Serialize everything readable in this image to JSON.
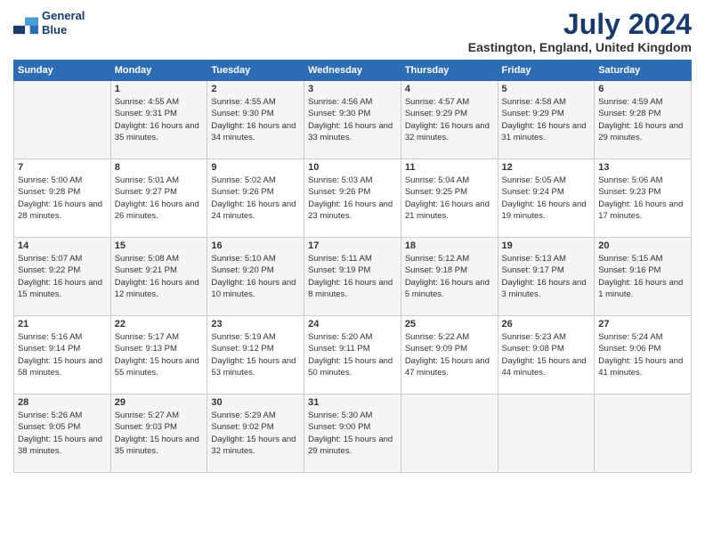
{
  "logo": {
    "line1": "General",
    "line2": "Blue"
  },
  "title": "July 2024",
  "location": "Eastington, England, United Kingdom",
  "days_of_week": [
    "Sunday",
    "Monday",
    "Tuesday",
    "Wednesday",
    "Thursday",
    "Friday",
    "Saturday"
  ],
  "weeks": [
    [
      {
        "day": "",
        "sunrise": "",
        "sunset": "",
        "daylight": ""
      },
      {
        "day": "1",
        "sunrise": "Sunrise: 4:55 AM",
        "sunset": "Sunset: 9:31 PM",
        "daylight": "Daylight: 16 hours and 35 minutes."
      },
      {
        "day": "2",
        "sunrise": "Sunrise: 4:55 AM",
        "sunset": "Sunset: 9:30 PM",
        "daylight": "Daylight: 16 hours and 34 minutes."
      },
      {
        "day": "3",
        "sunrise": "Sunrise: 4:56 AM",
        "sunset": "Sunset: 9:30 PM",
        "daylight": "Daylight: 16 hours and 33 minutes."
      },
      {
        "day": "4",
        "sunrise": "Sunrise: 4:57 AM",
        "sunset": "Sunset: 9:29 PM",
        "daylight": "Daylight: 16 hours and 32 minutes."
      },
      {
        "day": "5",
        "sunrise": "Sunrise: 4:58 AM",
        "sunset": "Sunset: 9:29 PM",
        "daylight": "Daylight: 16 hours and 31 minutes."
      },
      {
        "day": "6",
        "sunrise": "Sunrise: 4:59 AM",
        "sunset": "Sunset: 9:28 PM",
        "daylight": "Daylight: 16 hours and 29 minutes."
      }
    ],
    [
      {
        "day": "7",
        "sunrise": "Sunrise: 5:00 AM",
        "sunset": "Sunset: 9:28 PM",
        "daylight": "Daylight: 16 hours and 28 minutes."
      },
      {
        "day": "8",
        "sunrise": "Sunrise: 5:01 AM",
        "sunset": "Sunset: 9:27 PM",
        "daylight": "Daylight: 16 hours and 26 minutes."
      },
      {
        "day": "9",
        "sunrise": "Sunrise: 5:02 AM",
        "sunset": "Sunset: 9:26 PM",
        "daylight": "Daylight: 16 hours and 24 minutes."
      },
      {
        "day": "10",
        "sunrise": "Sunrise: 5:03 AM",
        "sunset": "Sunset: 9:26 PM",
        "daylight": "Daylight: 16 hours and 23 minutes."
      },
      {
        "day": "11",
        "sunrise": "Sunrise: 5:04 AM",
        "sunset": "Sunset: 9:25 PM",
        "daylight": "Daylight: 16 hours and 21 minutes."
      },
      {
        "day": "12",
        "sunrise": "Sunrise: 5:05 AM",
        "sunset": "Sunset: 9:24 PM",
        "daylight": "Daylight: 16 hours and 19 minutes."
      },
      {
        "day": "13",
        "sunrise": "Sunrise: 5:06 AM",
        "sunset": "Sunset: 9:23 PM",
        "daylight": "Daylight: 16 hours and 17 minutes."
      }
    ],
    [
      {
        "day": "14",
        "sunrise": "Sunrise: 5:07 AM",
        "sunset": "Sunset: 9:22 PM",
        "daylight": "Daylight: 16 hours and 15 minutes."
      },
      {
        "day": "15",
        "sunrise": "Sunrise: 5:08 AM",
        "sunset": "Sunset: 9:21 PM",
        "daylight": "Daylight: 16 hours and 12 minutes."
      },
      {
        "day": "16",
        "sunrise": "Sunrise: 5:10 AM",
        "sunset": "Sunset: 9:20 PM",
        "daylight": "Daylight: 16 hours and 10 minutes."
      },
      {
        "day": "17",
        "sunrise": "Sunrise: 5:11 AM",
        "sunset": "Sunset: 9:19 PM",
        "daylight": "Daylight: 16 hours and 8 minutes."
      },
      {
        "day": "18",
        "sunrise": "Sunrise: 5:12 AM",
        "sunset": "Sunset: 9:18 PM",
        "daylight": "Daylight: 16 hours and 5 minutes."
      },
      {
        "day": "19",
        "sunrise": "Sunrise: 5:13 AM",
        "sunset": "Sunset: 9:17 PM",
        "daylight": "Daylight: 16 hours and 3 minutes."
      },
      {
        "day": "20",
        "sunrise": "Sunrise: 5:15 AM",
        "sunset": "Sunset: 9:16 PM",
        "daylight": "Daylight: 16 hours and 1 minute."
      }
    ],
    [
      {
        "day": "21",
        "sunrise": "Sunrise: 5:16 AM",
        "sunset": "Sunset: 9:14 PM",
        "daylight": "Daylight: 15 hours and 58 minutes."
      },
      {
        "day": "22",
        "sunrise": "Sunrise: 5:17 AM",
        "sunset": "Sunset: 9:13 PM",
        "daylight": "Daylight: 15 hours and 55 minutes."
      },
      {
        "day": "23",
        "sunrise": "Sunrise: 5:19 AM",
        "sunset": "Sunset: 9:12 PM",
        "daylight": "Daylight: 15 hours and 53 minutes."
      },
      {
        "day": "24",
        "sunrise": "Sunrise: 5:20 AM",
        "sunset": "Sunset: 9:11 PM",
        "daylight": "Daylight: 15 hours and 50 minutes."
      },
      {
        "day": "25",
        "sunrise": "Sunrise: 5:22 AM",
        "sunset": "Sunset: 9:09 PM",
        "daylight": "Daylight: 15 hours and 47 minutes."
      },
      {
        "day": "26",
        "sunrise": "Sunrise: 5:23 AM",
        "sunset": "Sunset: 9:08 PM",
        "daylight": "Daylight: 15 hours and 44 minutes."
      },
      {
        "day": "27",
        "sunrise": "Sunrise: 5:24 AM",
        "sunset": "Sunset: 9:06 PM",
        "daylight": "Daylight: 15 hours and 41 minutes."
      }
    ],
    [
      {
        "day": "28",
        "sunrise": "Sunrise: 5:26 AM",
        "sunset": "Sunset: 9:05 PM",
        "daylight": "Daylight: 15 hours and 38 minutes."
      },
      {
        "day": "29",
        "sunrise": "Sunrise: 5:27 AM",
        "sunset": "Sunset: 9:03 PM",
        "daylight": "Daylight: 15 hours and 35 minutes."
      },
      {
        "day": "30",
        "sunrise": "Sunrise: 5:29 AM",
        "sunset": "Sunset: 9:02 PM",
        "daylight": "Daylight: 15 hours and 32 minutes."
      },
      {
        "day": "31",
        "sunrise": "Sunrise: 5:30 AM",
        "sunset": "Sunset: 9:00 PM",
        "daylight": "Daylight: 15 hours and 29 minutes."
      },
      {
        "day": "",
        "sunrise": "",
        "sunset": "",
        "daylight": ""
      },
      {
        "day": "",
        "sunrise": "",
        "sunset": "",
        "daylight": ""
      },
      {
        "day": "",
        "sunrise": "",
        "sunset": "",
        "daylight": ""
      }
    ]
  ]
}
